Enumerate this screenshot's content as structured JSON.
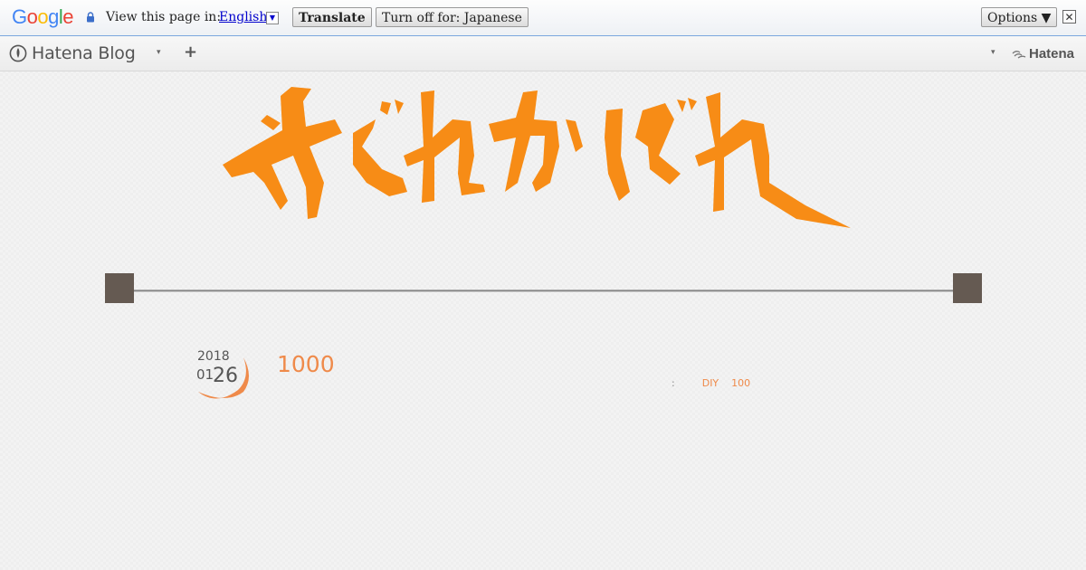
{
  "translate_bar": {
    "google_logo": "Google",
    "prompt": "View this page in:",
    "language": "English",
    "translate_button": "Translate",
    "turn_off_button": "Turn off for: Japanese",
    "options_button": "Options ▼",
    "close": "✕"
  },
  "hatena_bar": {
    "logo_text": "Hatena Blog",
    "menu_caret": "▾",
    "add": "+",
    "right_caret": "▾",
    "hatena_link": "Hatena"
  },
  "entry": {
    "year": "2018",
    "month": "01",
    "day": "26",
    "title": "1000",
    "meta_separator": ":",
    "categories": [
      "DIY",
      "100"
    ]
  },
  "colors": {
    "accent": "#ef8a4a",
    "title_art": "#f78c16",
    "divider": "#655a52",
    "link": "#0000cc"
  }
}
